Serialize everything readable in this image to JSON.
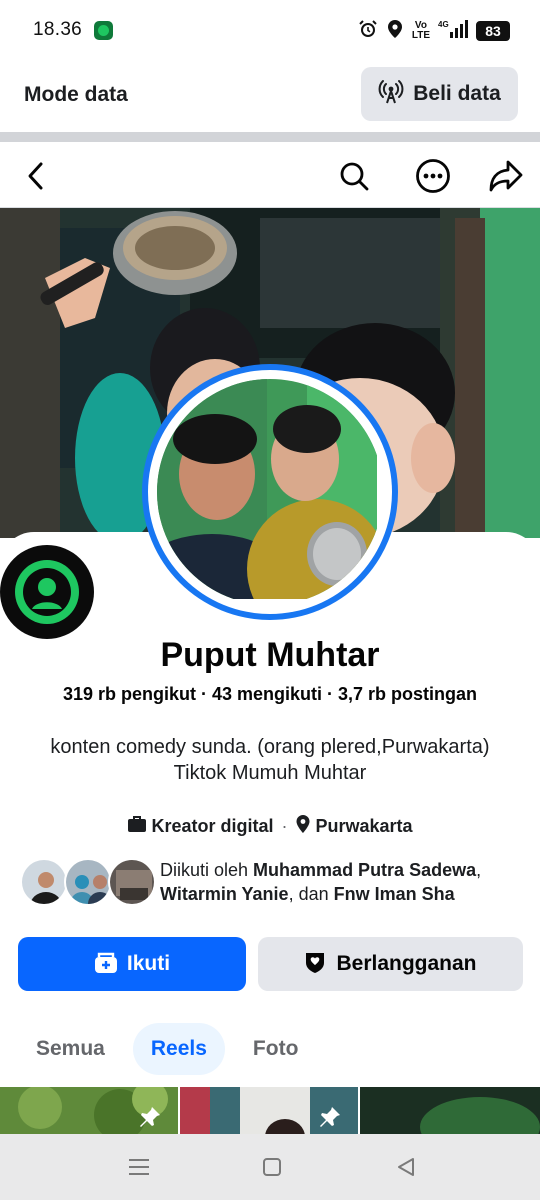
{
  "status_bar": {
    "time": "18.36",
    "network_label": "4G",
    "volte": "Vo LTE",
    "battery": "83"
  },
  "data_banner": {
    "title": "Mode data",
    "buy_label": "Beli data"
  },
  "profile": {
    "name": "Puput Muhtar",
    "followers": "319 rb pengikut",
    "following": "43 mengikuti",
    "posts": "3,7 rb postingan",
    "bio_line1": "konten comedy sunda. (orang plered,Purwakarta)",
    "bio_line2": "Tiktok Mumuh Muhtar",
    "category": "Kreator digital",
    "location": "Purwakarta"
  },
  "followed_by": {
    "prefix": "Diikuti oleh ",
    "name1": "Muhammad Putra Sadewa",
    "comma": ",",
    "name2": "Witarmin Yanie",
    "middle": ", dan ",
    "name3": "Fnw Iman Sha"
  },
  "actions": {
    "follow_label": "Ikuti",
    "subscribe_label": "Berlangganan"
  },
  "tabs": [
    {
      "label": "Semua",
      "active": false
    },
    {
      "label": "Reels",
      "active": true
    },
    {
      "label": "Foto",
      "active": false
    }
  ],
  "colors": {
    "accent": "#0866ff",
    "ring": "#1877f2",
    "button_gray": "#e4e6eb",
    "text": "#050505"
  }
}
